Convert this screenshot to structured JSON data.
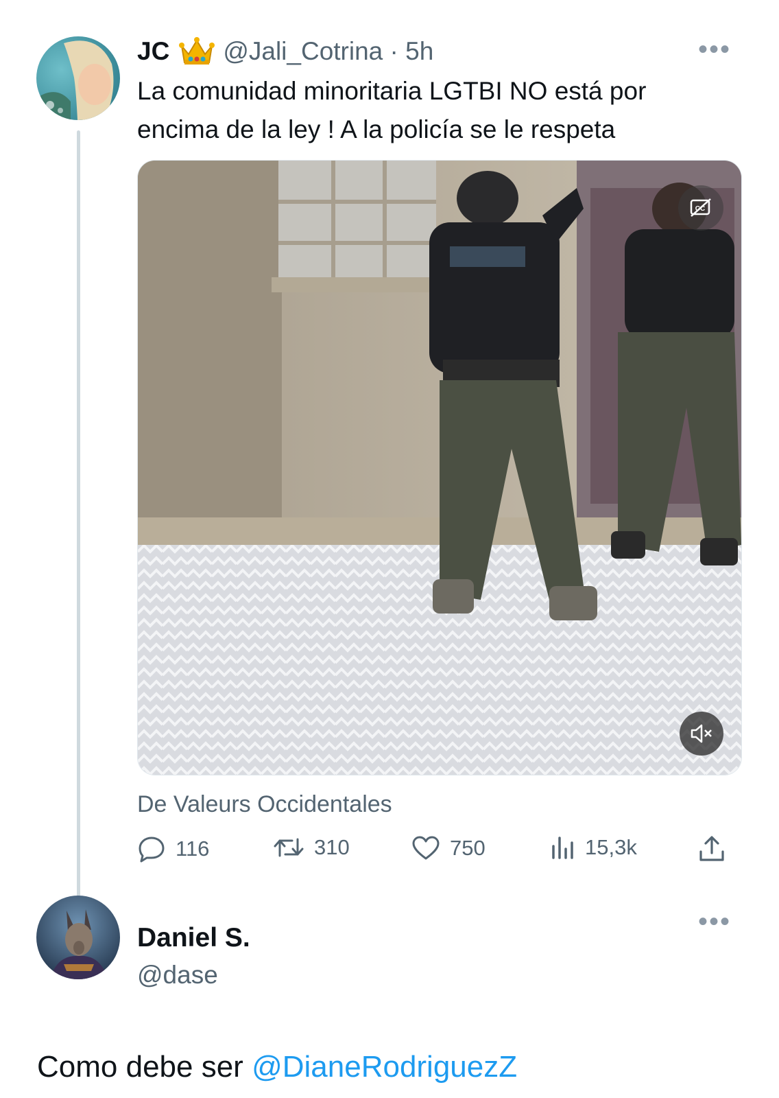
{
  "tweet": {
    "author_name": "JC",
    "author_badge_icon": "crown-emoji",
    "handle_time": "@Jali_Cotrina · 5h",
    "text_line1": "La comunidad minoritaria LGTBI NO está por",
    "text_line2": "encima de la ley !  A la policía se le respeta",
    "media_source": "De Valeurs Occidentales",
    "stats": {
      "replies": "116",
      "retweets": "310",
      "likes": "750",
      "views": "15,3k"
    }
  },
  "reply": {
    "author_name": "Daniel S.",
    "handle": "@dase",
    "text": "Como debe ser ",
    "mention": "@DianeRodriguezZ"
  },
  "colors": {
    "link": "#1d9bf0",
    "secondary_text": "#536471",
    "thread_line": "#cfd9de"
  }
}
